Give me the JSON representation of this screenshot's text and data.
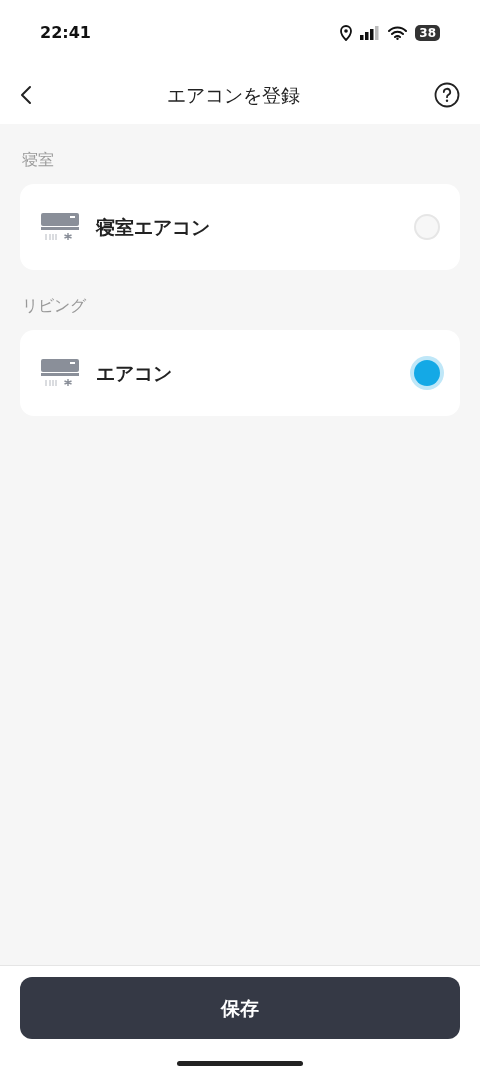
{
  "status_bar": {
    "time": "22:41",
    "battery": "38"
  },
  "header": {
    "title": "エアコンを登録"
  },
  "groups": [
    {
      "label": "寝室",
      "devices": [
        {
          "name": "寝室エアコン",
          "selected": false
        }
      ]
    },
    {
      "label": "リビング",
      "devices": [
        {
          "name": "エアコン",
          "selected": true
        }
      ]
    }
  ],
  "save_button": "保存"
}
